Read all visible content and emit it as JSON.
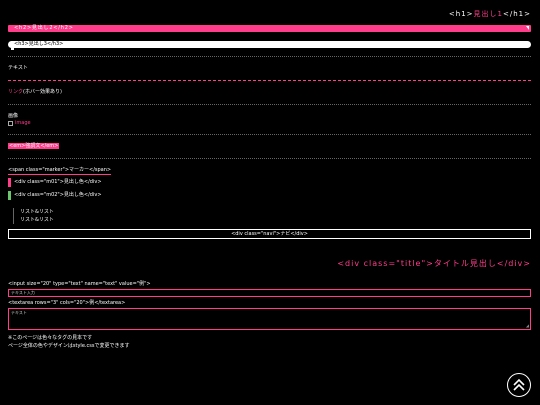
{
  "h1": {
    "prefix": "<h1>",
    "text": "見出し1",
    "suffix": "</h1>"
  },
  "h2": "<h2>見出し2</h2>",
  "h3": "<h3>見出し3</h3>",
  "text_sample": "テキスト",
  "link_row": {
    "link": "リンク",
    "text": "(ホバー効果あり)"
  },
  "image_label": "画像",
  "image_alt": "image",
  "em_row": "<em>強調文</em>",
  "span_marker": "<span class=\"marker\">マーカー</span>",
  "m01": "<div class=\"m01\">見出し色</div>",
  "m02": "<div class=\"m02\">見出し色</div>",
  "list_items": [
    "リスト&amp;リスト",
    "リスト&amp;リスト"
  ],
  "nav": "<div class=\"navi\">ナビ</div>",
  "title": {
    "prefix": "<div class=\"title\">",
    "text": "タイトル見出し",
    "suffix": "</div>"
  },
  "form": {
    "input_label": "<input size=\"20\" type=\"text\" name=\"text\" value=\"例\">",
    "input_value": "テキスト入力",
    "textarea_label": "<textarea rows=\"3\" cols=\"20\">例</textarea>",
    "textarea_value": "テキスト"
  },
  "notes": [
    "※このページは色々なタグの見本です",
    "ページ全体の色やデザインはstyle.cssで変更できます"
  ],
  "colors": {
    "accent": "#ff3d8b",
    "green": "#6cc76c",
    "background": "#000000"
  },
  "icons": {
    "totop": "arrow-up-icon"
  }
}
